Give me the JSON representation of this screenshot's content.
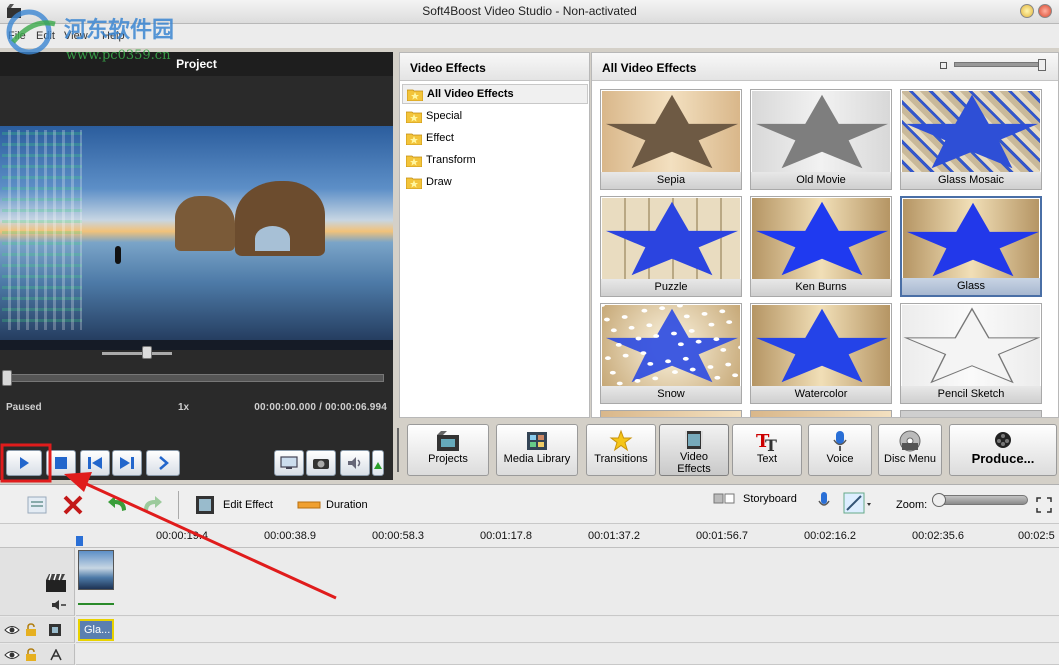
{
  "window": {
    "title": "Soft4Boost Video Studio - Non-activated"
  },
  "menu": {
    "items": [
      "File",
      "Edit",
      "View",
      "Help"
    ]
  },
  "watermark": {
    "line1": "河东软件园",
    "line2": "www.pc0359.cn"
  },
  "preview": {
    "title": "Project",
    "status": "Paused",
    "speed": "1x",
    "time": "00:00:00.000 / 00:00:06.994",
    "speed_level": 0.6,
    "seek_position": 0.0
  },
  "effects_panel": {
    "title": "Video Effects",
    "categories": [
      {
        "label": "All Video Effects",
        "selected": true
      },
      {
        "label": "Special"
      },
      {
        "label": "Effect"
      },
      {
        "label": "Transform"
      },
      {
        "label": "Draw"
      }
    ]
  },
  "grid_panel": {
    "title": "All Video Effects",
    "tiles": [
      {
        "label": "Sepia",
        "style": "sepia"
      },
      {
        "label": "Old Movie",
        "style": "oldmovie"
      },
      {
        "label": "Glass Mosaic",
        "style": "mosaic"
      },
      {
        "label": "Puzzle",
        "style": "puzzle"
      },
      {
        "label": "Ken Burns",
        "style": "kenburns"
      },
      {
        "label": "Glass",
        "style": "glass",
        "selected": true
      },
      {
        "label": "Snow",
        "style": "snow"
      },
      {
        "label": "Watercolor",
        "style": "watercolor"
      },
      {
        "label": "Pencil Sketch",
        "style": "pencil"
      }
    ]
  },
  "toolbar": {
    "buttons": [
      {
        "label": "Projects",
        "icon": "projects-icon"
      },
      {
        "label": "Media Library",
        "icon": "media-library-icon"
      },
      {
        "label": "Transitions",
        "icon": "star-icon"
      },
      {
        "label": "Video\nEffects",
        "icon": "film-effects-icon",
        "active": true
      },
      {
        "label": "Text",
        "icon": "text-tt-icon"
      },
      {
        "label": "Voice",
        "icon": "microphone-icon"
      },
      {
        "label": "Disc Menu",
        "icon": "disc-menu-icon"
      },
      {
        "label": "Produce...",
        "icon": "film-reel-icon"
      }
    ]
  },
  "timeline_toolbar": {
    "edit_effect": "Edit Effect",
    "duration": "Duration",
    "storyboard": "Storyboard",
    "zoom": "Zoom:"
  },
  "ruler": {
    "marks": [
      "00:00:19.4",
      "00:00:38.9",
      "00:00:58.3",
      "00:01:17.8",
      "00:01:37.2",
      "00:01:56.7",
      "00:02:16.2",
      "00:02:35.6",
      "00:02:5"
    ]
  },
  "tracks": {
    "effect_clip_label": "Gla..."
  },
  "colors": {
    "accent_red": "#e01c1c",
    "selected_tile": "#4a6fa6",
    "watermark_blue": "#3b86d2",
    "watermark_green": "#39a94a"
  }
}
